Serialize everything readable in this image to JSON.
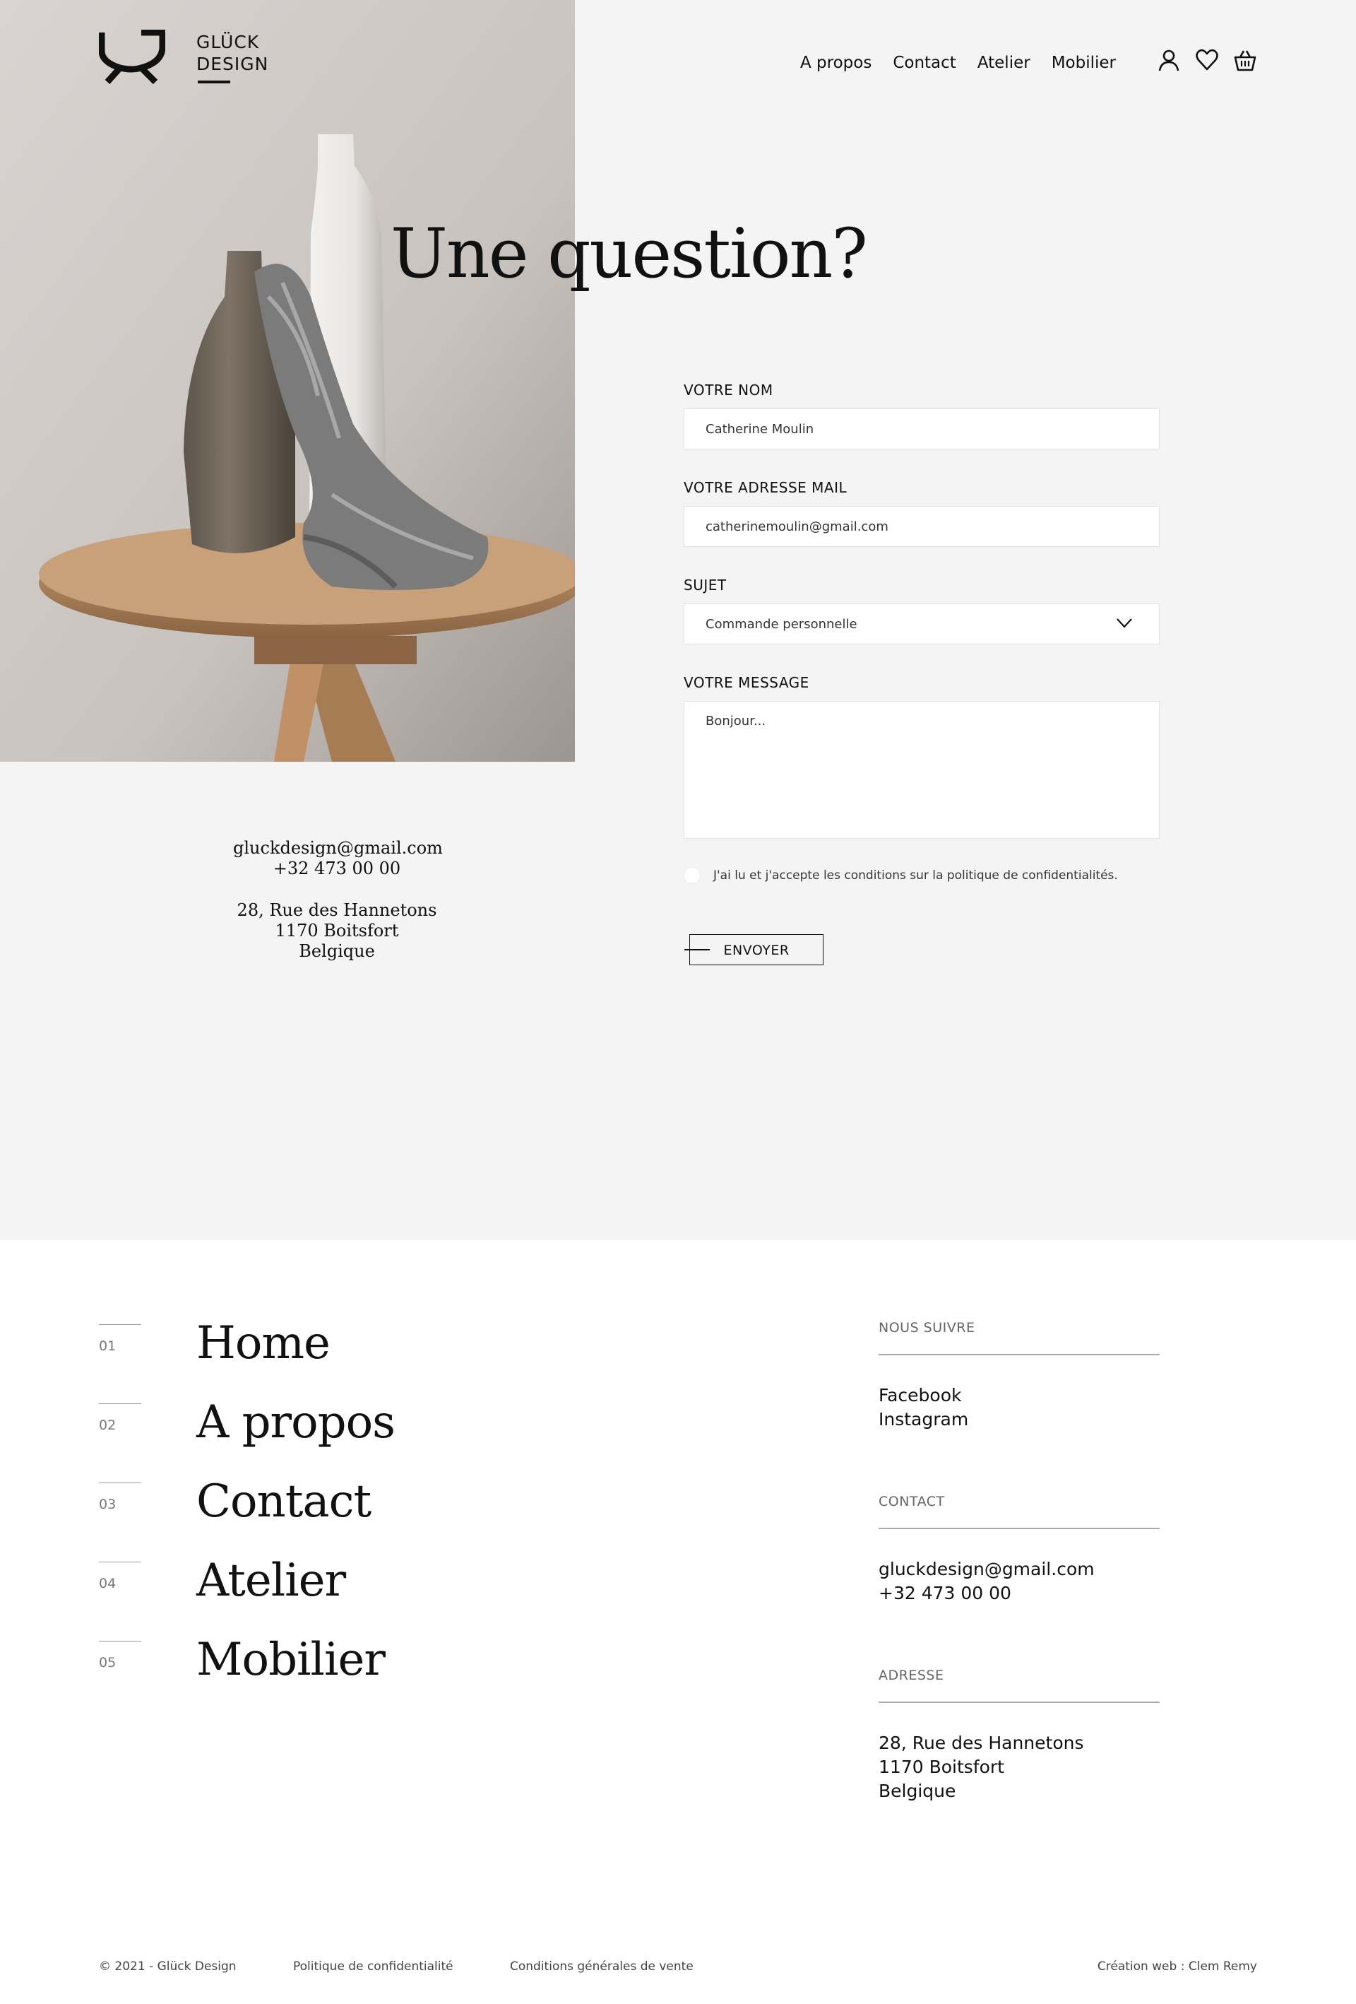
{
  "brand": {
    "line1": "GLÜCK",
    "line2": "DESIGN"
  },
  "nav": [
    {
      "label": "A propos"
    },
    {
      "label": "Contact"
    },
    {
      "label": "Atelier"
    },
    {
      "label": "Mobilier"
    }
  ],
  "icons": [
    "user-icon",
    "heart-icon",
    "basket-icon"
  ],
  "page_title": "Une question?",
  "form": {
    "name": {
      "label": "VOTRE NOM",
      "value": "Catherine Moulin"
    },
    "email": {
      "label": "VOTRE ADRESSE MAIL",
      "value": "catherinemoulin@gmail.com"
    },
    "subject": {
      "label": "SUJET",
      "value": "Commande personnelle"
    },
    "message": {
      "label": "VOTRE MESSAGE",
      "placeholder": "Bonjour..."
    },
    "consent": "J'ai lu et j'accepte les conditions sur la politique de confidentialités.",
    "submit": "ENVOYER"
  },
  "contact_block": {
    "email": "gluckdesign@gmail.com",
    "phone": "+32 473 00 00",
    "street": "28, Rue des Hannetons",
    "city": "1170 Boitsfort",
    "country": "Belgique"
  },
  "footer_nav": [
    {
      "num": "01",
      "label": "Home"
    },
    {
      "num": "02",
      "label": "A propos"
    },
    {
      "num": "03",
      "label": "Contact"
    },
    {
      "num": "04",
      "label": "Atelier"
    },
    {
      "num": "05",
      "label": "Mobilier"
    }
  ],
  "footer_cols": {
    "follow": {
      "title": "NOUS SUIVRE",
      "lines": [
        "Facebook",
        "Instagram"
      ]
    },
    "contact": {
      "title": "CONTACT",
      "lines": [
        "gluckdesign@gmail.com",
        "+32 473 00 00"
      ]
    },
    "address": {
      "title": "ADRESSE",
      "lines": [
        "28, Rue des Hannetons",
        "1170 Boitsfort",
        "Belgique"
      ]
    }
  },
  "bottom_bar": {
    "copyright": "© 2021 - Glück Design",
    "privacy": "Politique de confidentialité",
    "terms": "Conditions générales de vente",
    "credit": "Création web : Clem Remy"
  },
  "colors": {
    "page_bg": "#f4f4f4",
    "footer_bg": "#ffffff",
    "text": "#111111"
  }
}
